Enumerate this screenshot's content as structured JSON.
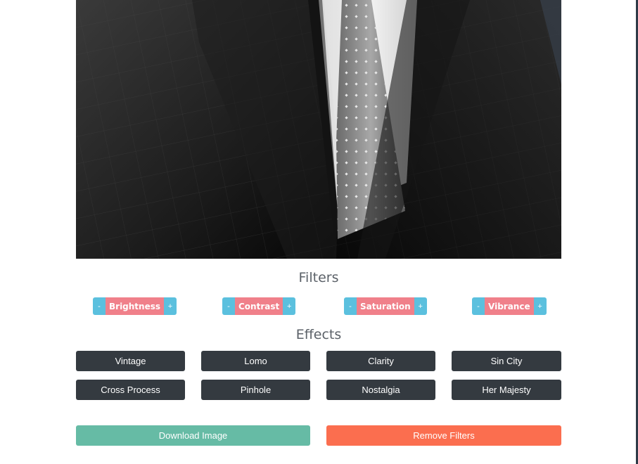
{
  "photo": {
    "alt": "Suit and tie photo"
  },
  "filters": {
    "title": "Filters",
    "items": [
      {
        "label": "Brightness",
        "minus": "-",
        "plus": "+"
      },
      {
        "label": "Contrast",
        "minus": "-",
        "plus": "+"
      },
      {
        "label": "Saturation",
        "minus": "-",
        "plus": "+"
      },
      {
        "label": "Vibrance",
        "minus": "-",
        "plus": "+"
      }
    ]
  },
  "effects": {
    "title": "Effects",
    "items": [
      {
        "label": "Vintage"
      },
      {
        "label": "Lomo"
      },
      {
        "label": "Clarity"
      },
      {
        "label": "Sin City"
      },
      {
        "label": "Cross Process"
      },
      {
        "label": "Pinhole"
      },
      {
        "label": "Nostalgia"
      },
      {
        "label": "Her Majesty"
      }
    ]
  },
  "actions": {
    "download_label": "Download Image",
    "remove_label": "Remove Filters"
  },
  "colors": {
    "filter_button": "#5bc0de",
    "filter_label": "#f0808a",
    "effect_button": "#343a40",
    "download": "#66bba5",
    "remove": "#fb6e4f"
  }
}
